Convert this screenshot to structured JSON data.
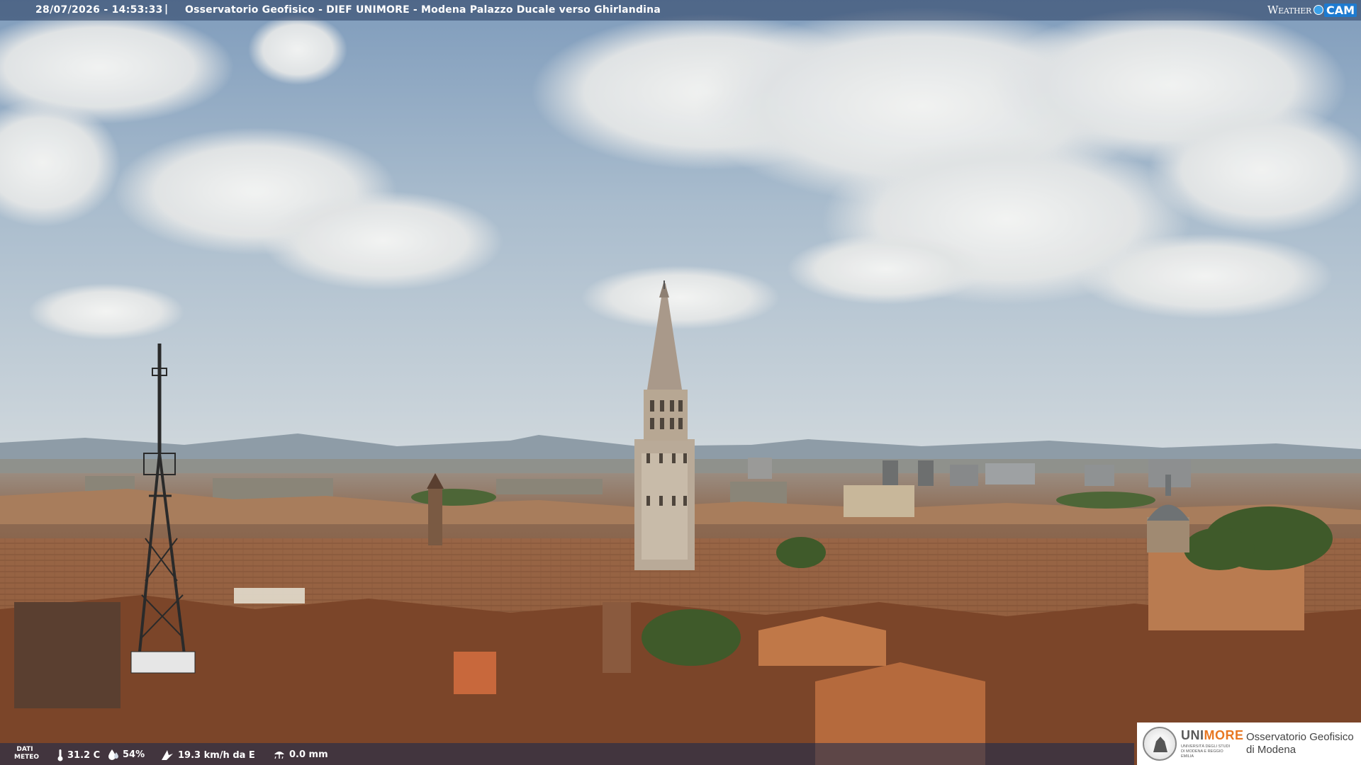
{
  "overlay": {
    "timestamp": "28/07/2026 - 14:53:33",
    "separator": "|",
    "title": "Osservatorio Geofisico - DIEF UNIMORE - Modena Palazzo Ducale verso Ghirlandina"
  },
  "brand": {
    "weather": "Weather",
    "cam": "CAM"
  },
  "meteo": {
    "label_line1": "DATI",
    "label_line2": "METEO",
    "temperature": "31.2 C",
    "humidity": "54%",
    "wind": "19.3 km/h da E",
    "rain": "0.0 mm",
    "icons": [
      "thermometer-icon",
      "humidity-icon",
      "wind-icon",
      "rain-icon"
    ]
  },
  "logo": {
    "uni_part1": "UNI",
    "uni_part2": "MORE",
    "university": "UNIVERSITÀ DEGLI STUDI DI MODENA E REGGIO EMILIA",
    "observatory_line1": "Osservatorio Geofisico",
    "observatory_line2": "di Modena",
    "accent": "#e87722"
  },
  "colors": {
    "sky_top": "#7f9cbc",
    "sky_bottom": "#c9d3da",
    "roofs": "#a66a45",
    "overlay_bar": "#283c5f"
  }
}
